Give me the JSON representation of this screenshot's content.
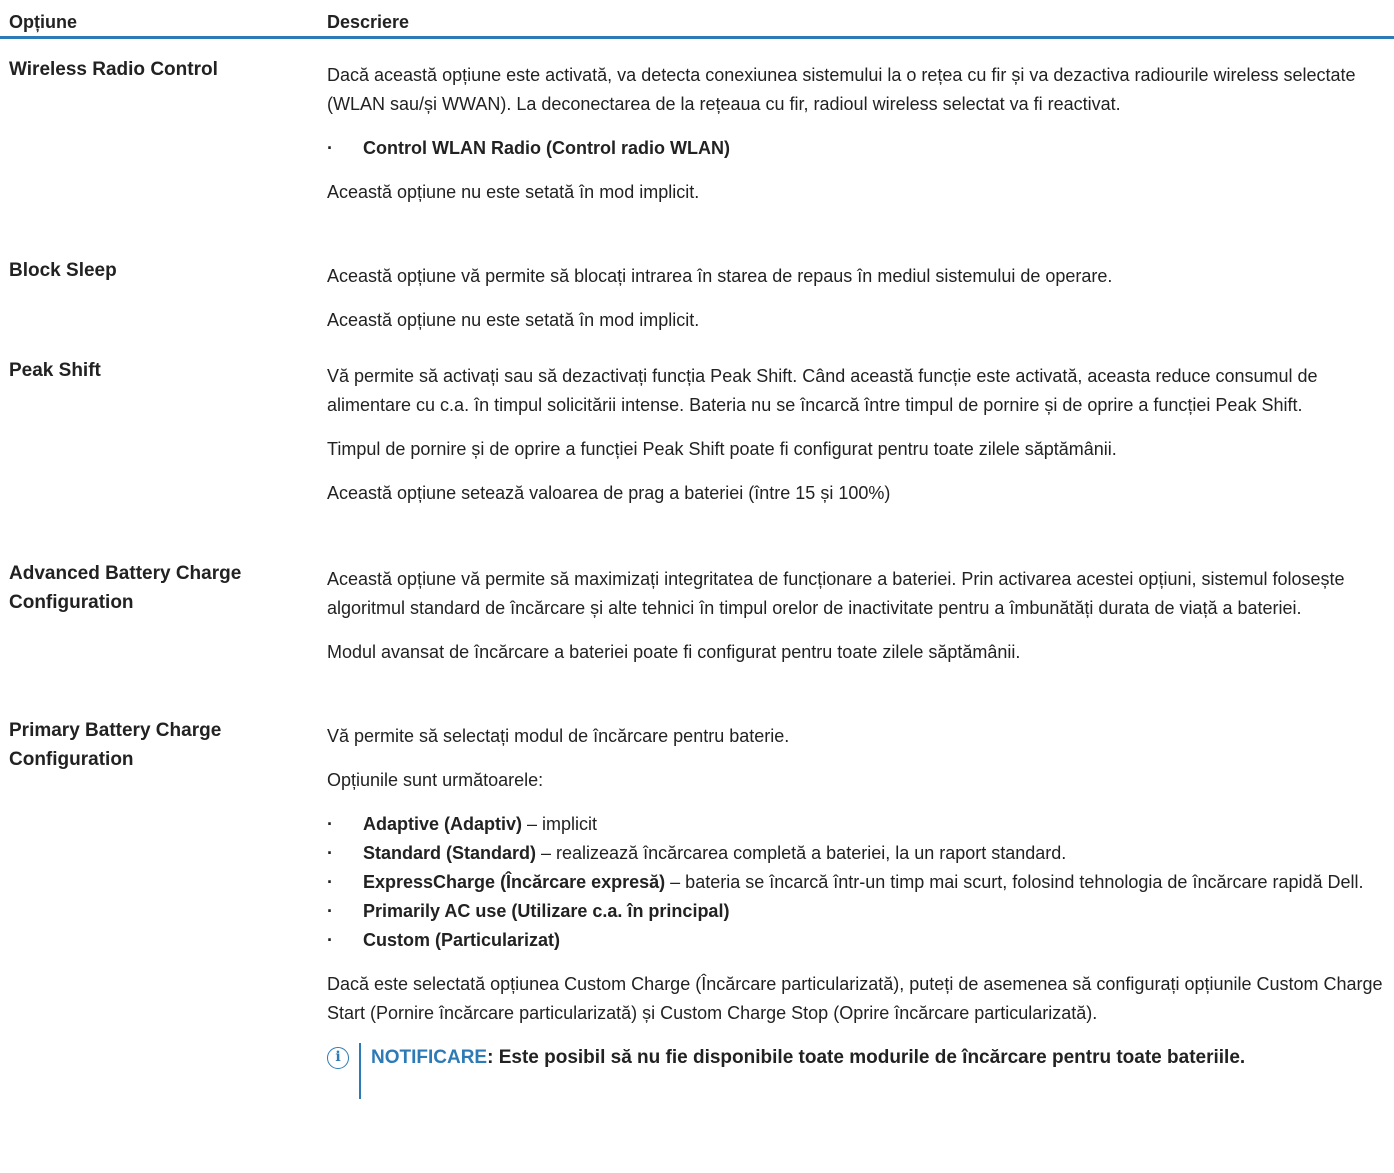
{
  "header": {
    "col_option": "Opțiune",
    "col_description": "Descriere"
  },
  "rows": [
    {
      "option": "Wireless Radio Control",
      "p1": "Dacă această opțiune este activată, va detecta conexiunea sistemului la o rețea cu fir și va dezactiva radiourile wireless selectate (WLAN sau/și WWAN). La deconectarea de la rețeaua cu fir, radioul wireless selectat va fi reactivat.",
      "bullet": "Control WLAN Radio (Control radio WLAN)",
      "p2": "Această opțiune nu este setată în mod implicit."
    },
    {
      "option": "Block Sleep",
      "p1": "Această opțiune vă permite să blocați intrarea în starea de repaus în mediul sistemului de operare.",
      "p2": "Această opțiune nu este setată în mod implicit."
    },
    {
      "option": "Peak Shift",
      "p1": "Vă permite să activați sau să dezactivați funcția Peak Shift. Când această funcție este activată, aceasta reduce consumul de alimentare cu c.a. în timpul solicitării intense. Bateria nu se încarcă între timpul de pornire și de oprire a funcției Peak Shift.",
      "p2": "Timpul de pornire și de oprire a funcției Peak Shift poate fi configurat pentru toate zilele săptămânii.",
      "p3": "Această opțiune setează valoarea de prag a bateriei (între 15 și 100%)"
    },
    {
      "option": "Advanced Battery Charge Configuration",
      "p1": "Această opțiune vă permite să maximizați integritatea de funcționare a bateriei. Prin activarea acestei opțiuni, sistemul folosește algoritmul standard de încărcare și alte tehnici în timpul orelor de inactivitate pentru a îmbunătăți durata de viață a bateriei.",
      "p2": "Modul avansat de încărcare a bateriei poate fi configurat pentru toate zilele săptămânii."
    },
    {
      "option": "Primary Battery Charge Configuration",
      "p1": "Vă permite să selectați modul de încărcare pentru baterie.",
      "p2": "Opțiunile sunt următoarele:",
      "bullets": [
        {
          "bold": "Adaptive (Adaptiv)",
          "text": " – implicit"
        },
        {
          "bold": "Standard (Standard)",
          "text": " – realizează încărcarea completă a bateriei, la un raport standard."
        },
        {
          "bold": "ExpressCharge (Încărcare expresă)",
          "text": " – bateria se încarcă într-un timp mai scurt, folosind tehnologia de încărcare rapidă Dell."
        },
        {
          "bold": "Primarily AC use (Utilizare c.a. în principal)",
          "text": ""
        },
        {
          "bold": "Custom (Particularizat)",
          "text": ""
        }
      ],
      "p3": "Dacă este selectată opțiunea Custom Charge (Încărcare particularizată), puteți de asemenea să configurați opțiunile Custom Charge Start (Pornire încărcare particularizată) și Custom Charge Stop (Oprire încărcare particularizată).",
      "note_label": "NOTIFICARE",
      "note_text": ": Este posibil să nu fie disponibile toate modurile de încărcare pentru toate bateriile."
    }
  ]
}
